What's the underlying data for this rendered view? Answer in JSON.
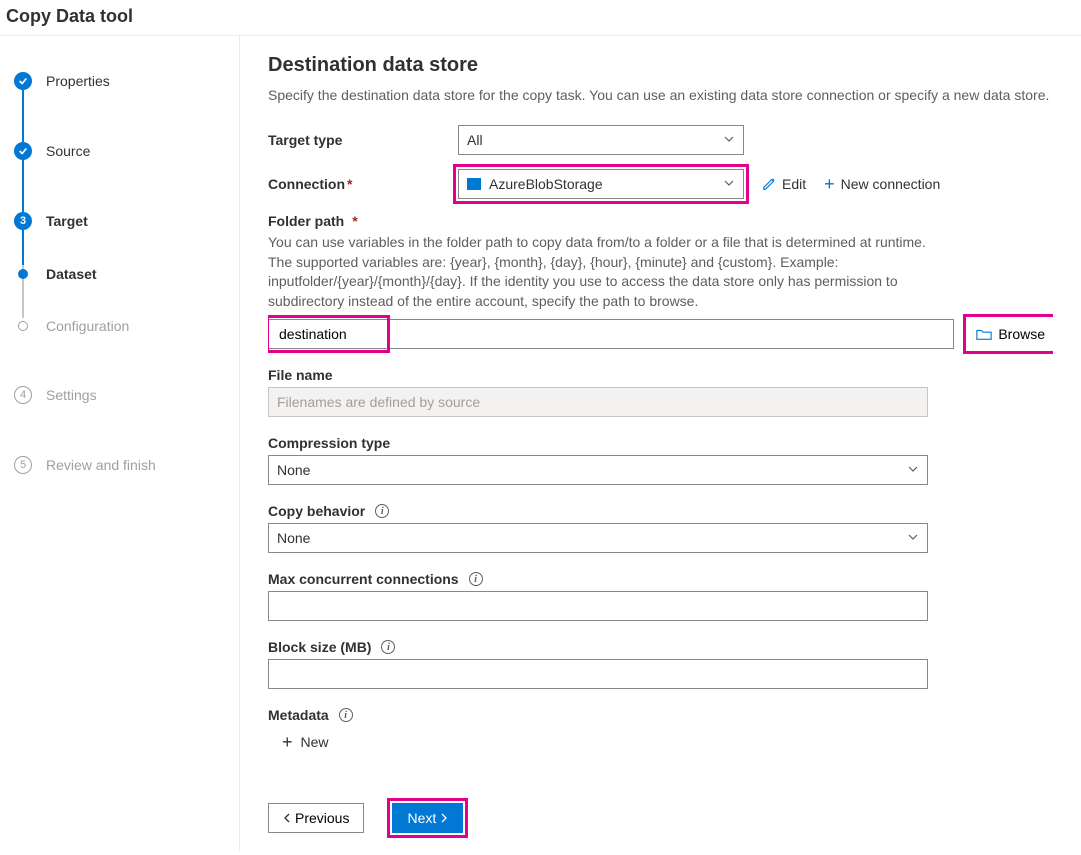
{
  "app_title": "Copy Data tool",
  "sidebar": {
    "steps": [
      {
        "label": "Properties"
      },
      {
        "label": "Source"
      },
      {
        "label": "Target",
        "num": "3"
      },
      {
        "label": "Dataset"
      },
      {
        "label": "Configuration"
      },
      {
        "label": "Settings",
        "num": "4"
      },
      {
        "label": "Review and finish",
        "num": "5"
      }
    ]
  },
  "page": {
    "title": "Destination data store",
    "description": "Specify the destination data store for the copy task. You can use an existing data store connection or specify a new data store."
  },
  "form": {
    "target_type_label": "Target type",
    "target_type_value": "All",
    "connection_label": "Connection",
    "connection_value": "AzureBlobStorage",
    "edit_label": "Edit",
    "new_connection_label": "New connection",
    "folder_path_label": "Folder path",
    "folder_help": "You can use variables in the folder path to copy data from/to a folder or a file that is determined at runtime. The supported variables are: {year}, {month}, {day}, {hour}, {minute} and {custom}. Example: inputfolder/{year}/{month}/{day}. If the identity you use to access the data store only has permission to subdirectory instead of the entire account, specify the path to browse.",
    "folder_value": "destination",
    "browse_label": "Browse",
    "filename_label": "File name",
    "filename_placeholder": "Filenames are defined by source",
    "compression_label": "Compression type",
    "compression_value": "None",
    "copy_behavior_label": "Copy behavior",
    "copy_behavior_value": "None",
    "max_conn_label": "Max concurrent connections",
    "max_conn_value": "",
    "block_size_label": "Block size (MB)",
    "block_size_value": "",
    "metadata_label": "Metadata",
    "metadata_new": "New"
  },
  "footer": {
    "previous": "Previous",
    "next": "Next"
  }
}
